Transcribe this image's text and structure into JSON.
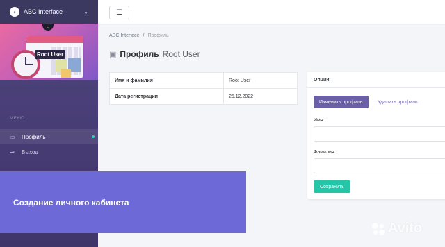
{
  "app": {
    "title": "ABC Interface"
  },
  "sidebar": {
    "user_name": "Root User",
    "menu_title": "МЕНЮ",
    "items": [
      {
        "label": "Профиль",
        "icon": "id-card-icon",
        "active": true
      },
      {
        "label": "Выход",
        "icon": "sign-out-icon",
        "active": false
      }
    ]
  },
  "breadcrumb": {
    "root": "ABC Interface",
    "separator": "/",
    "current": "Профиль"
  },
  "page": {
    "title_bold": "Профиль",
    "title_light": "Root User"
  },
  "info_table": {
    "rows": [
      {
        "label": "Имя и фамилия",
        "value": "Root User"
      },
      {
        "label": "Дата регистрации",
        "value": "25.12.2022"
      }
    ]
  },
  "options": {
    "header": "Опции",
    "edit_button": "Изменить профиль",
    "delete_link": "Удалить профиль",
    "first_name_label": "Имя:",
    "first_name_value": "",
    "last_name_label": "Фамилия:",
    "last_name_value": "",
    "save_button": "Сохранить"
  },
  "overlay": {
    "caption": "Создание личного кабинета"
  },
  "watermark": {
    "text": "Avito"
  },
  "colors": {
    "accent": "#6b5fa8",
    "success": "#25c5a8",
    "overlay": "#6d6ad8",
    "sidebar": "#4a3f78"
  }
}
